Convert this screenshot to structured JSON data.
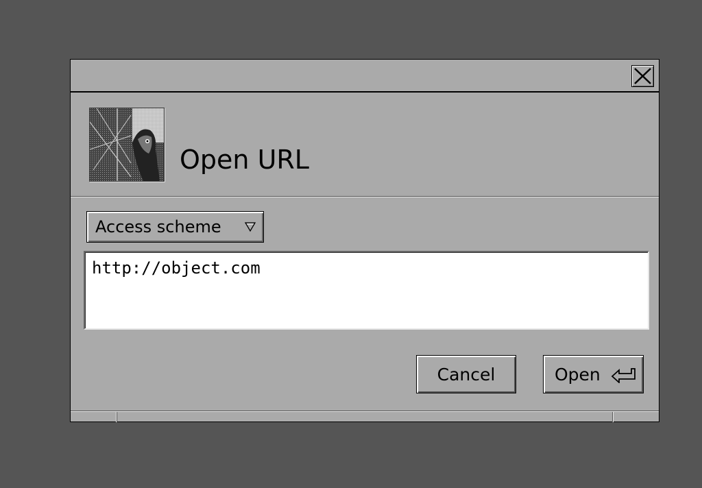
{
  "dialog": {
    "title": "Open URL",
    "close_icon": "close-icon",
    "app_icon": "umbrella-bird-icon"
  },
  "scheme_menu": {
    "label": "Access scheme",
    "arrow_icon": "triangle-down-icon"
  },
  "url_field": {
    "value": "http://object.com"
  },
  "buttons": {
    "cancel": "Cancel",
    "open": "Open",
    "open_icon": "return-key-icon"
  },
  "colors": {
    "desktop": "#555555",
    "dialog_bg": "#aaaaaa",
    "field_bg": "#ffffff"
  }
}
